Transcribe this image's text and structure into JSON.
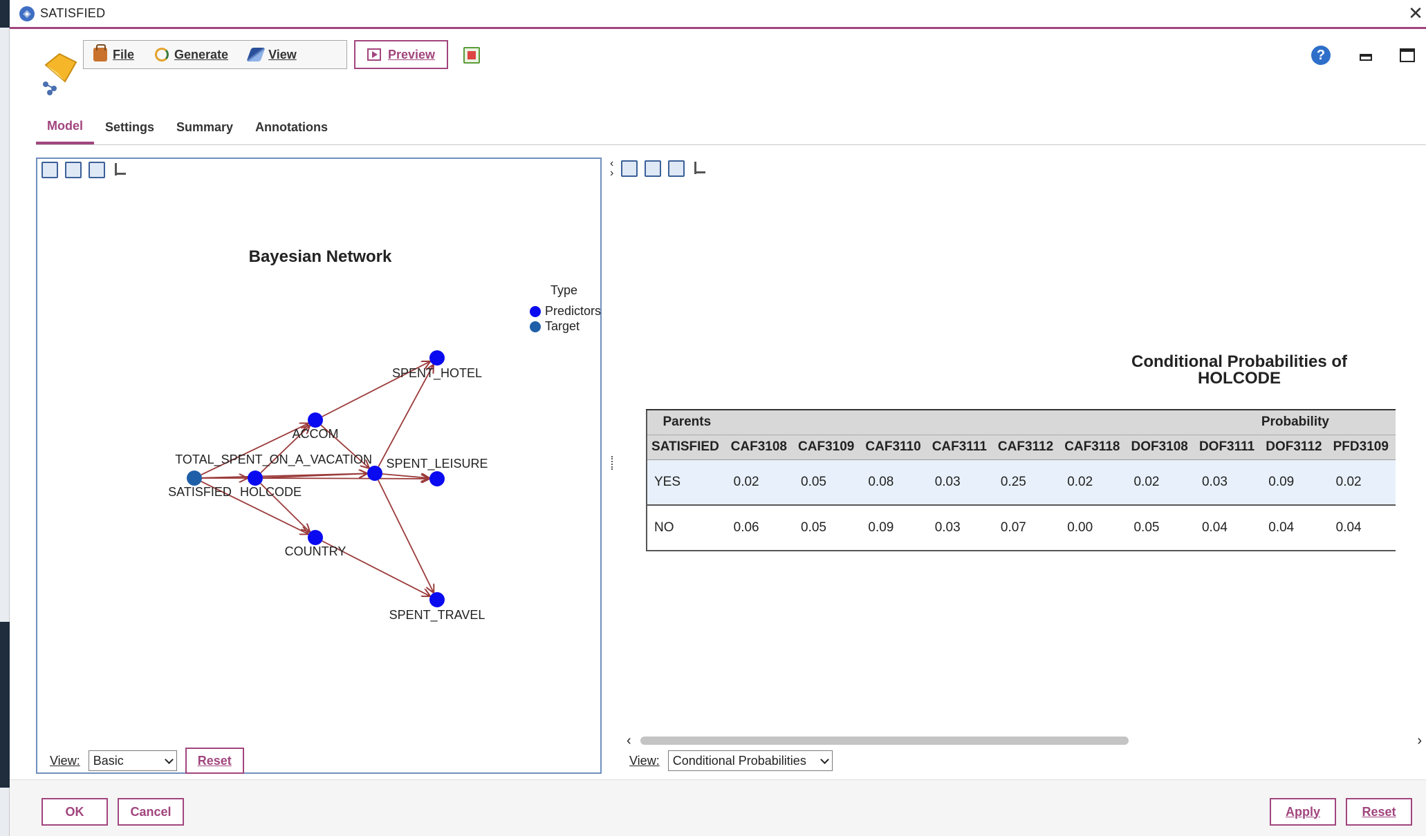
{
  "window": {
    "title": "SATISFIED",
    "close_glyph": "✕"
  },
  "toolbar": {
    "file_label": "File",
    "generate_label": "Generate",
    "view_label": "View",
    "preview_label": "Preview"
  },
  "tabs": [
    {
      "label": "Model",
      "active": true
    },
    {
      "label": "Settings",
      "active": false
    },
    {
      "label": "Summary",
      "active": false
    },
    {
      "label": "Annotations",
      "active": false
    }
  ],
  "network": {
    "title": "Bayesian Network",
    "legend_title": "Type",
    "legend": [
      {
        "label": "Predictors",
        "color": "#0a0af0"
      },
      {
        "label": "Target",
        "color": "#1f5fa8"
      }
    ],
    "nodes": [
      {
        "id": "SATISFIED",
        "label": "SATISFIED",
        "type": "Target"
      },
      {
        "id": "HOLCODE",
        "label": "HOLCODE",
        "type": "Predictors"
      },
      {
        "id": "ACCOM",
        "label": "ACCOM",
        "type": "Predictors"
      },
      {
        "id": "COUNTRY",
        "label": "COUNTRY",
        "type": "Predictors"
      },
      {
        "id": "TOTAL",
        "label": "TOTAL_SPENT_ON_A_VACATION",
        "type": "Predictors"
      },
      {
        "id": "HOTEL",
        "label": "SPENT_HOTEL",
        "type": "Predictors"
      },
      {
        "id": "LEISURE",
        "label": "SPENT_LEISURE",
        "type": "Predictors"
      },
      {
        "id": "TRAVEL",
        "label": "SPENT_TRAVEL",
        "type": "Predictors"
      }
    ],
    "edges": [
      [
        "SATISFIED",
        "HOLCODE"
      ],
      [
        "SATISFIED",
        "ACCOM"
      ],
      [
        "SATISFIED",
        "COUNTRY"
      ],
      [
        "SATISFIED",
        "TOTAL"
      ],
      [
        "HOLCODE",
        "ACCOM"
      ],
      [
        "HOLCODE",
        "COUNTRY"
      ],
      [
        "HOLCODE",
        "TOTAL"
      ],
      [
        "HOLCODE",
        "LEISURE"
      ],
      [
        "ACCOM",
        "HOTEL"
      ],
      [
        "ACCOM",
        "TOTAL"
      ],
      [
        "COUNTRY",
        "TRAVEL"
      ],
      [
        "TOTAL",
        "HOTEL"
      ],
      [
        "TOTAL",
        "LEISURE"
      ],
      [
        "TOTAL",
        "TRAVEL"
      ]
    ],
    "edge_color": "#9b3a3a",
    "view_label": "View:",
    "view_value": "Basic",
    "reset_label": "Reset"
  },
  "cond_prob": {
    "title_line1": "Conditional Probabilities  of",
    "title_line2": "HOLCODE",
    "parents_label": "Parents",
    "probability_label": "Probability",
    "columns": [
      "SATISFIED",
      "CAF3108",
      "CAF3109",
      "CAF3110",
      "CAF3111",
      "CAF3112",
      "CAF3118",
      "DOF3108",
      "DOF3111",
      "DOF3112",
      "PFD3109"
    ],
    "rows": [
      [
        "YES",
        "0.02",
        "0.05",
        "0.08",
        "0.03",
        "0.25",
        "0.02",
        "0.02",
        "0.03",
        "0.09",
        "0.02"
      ],
      [
        "NO",
        "0.06",
        "0.05",
        "0.09",
        "0.03",
        "0.07",
        "0.00",
        "0.05",
        "0.04",
        "0.04",
        "0.04"
      ]
    ],
    "view_label": "View:",
    "view_value": "Conditional Probabilities"
  },
  "footer": {
    "ok_label": "OK",
    "cancel_label": "Cancel",
    "apply_label": "Apply",
    "reset_label": "Reset"
  },
  "colors": {
    "accent": "#a1457e",
    "predictor": "#0a0af0",
    "target": "#1f5fa8"
  }
}
